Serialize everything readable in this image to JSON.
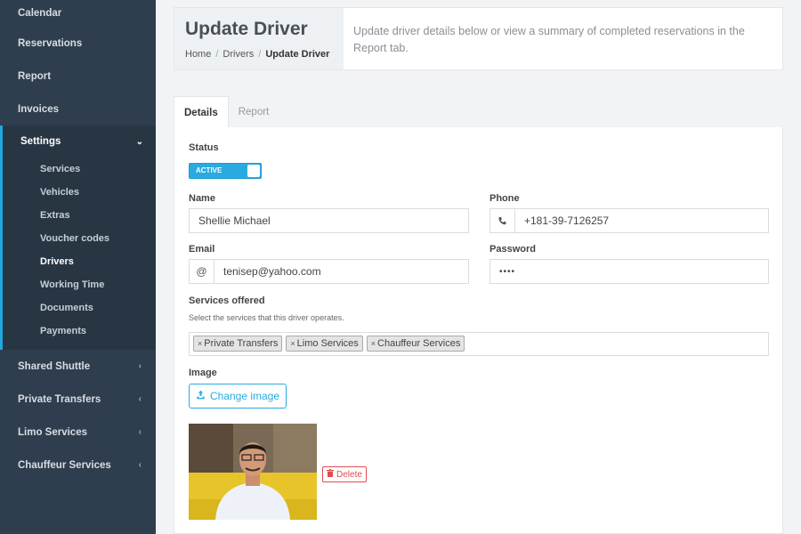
{
  "sidebar": {
    "top_items": [
      "Calendar",
      "Reservations",
      "Report",
      "Invoices"
    ],
    "settings": {
      "label": "Settings",
      "items": [
        "Services",
        "Vehicles",
        "Extras",
        "Voucher codes",
        "Drivers",
        "Working Time",
        "Documents",
        "Payments"
      ]
    },
    "bottom_items": [
      "Shared Shuttle",
      "Private Transfers",
      "Limo Services",
      "Chauffeur Services"
    ]
  },
  "header": {
    "title": "Update Driver",
    "breadcrumb": [
      "Home",
      "Drivers",
      "Update Driver"
    ],
    "description": "Update driver details below or view a summary of completed reservations in the Report tab."
  },
  "tabs": [
    "Details",
    "Report"
  ],
  "form": {
    "status_label": "Status",
    "status_value": "ACTIVE",
    "name_label": "Name",
    "name_value": "Shellie Michael",
    "phone_label": "Phone",
    "phone_value": "+181-39-7126257",
    "email_label": "Email",
    "email_value": "tenisep@yahoo.com",
    "email_addon": "@",
    "password_label": "Password",
    "password_value": "••••",
    "services_label": "Services offered",
    "services_hint": "Select the services that this driver operates.",
    "services": [
      "Private Transfers",
      "Limo Services",
      "Chauffeur Services"
    ],
    "image_label": "Image",
    "change_image": "Change image",
    "delete": "Delete"
  },
  "colors": {
    "accent": "#29abe2",
    "sidebar": "#2f3e4e",
    "danger": "#e24b4b"
  },
  "icons": [
    "chevron-down-icon",
    "chevron-left-icon",
    "phone-icon",
    "upload-icon",
    "trash-icon",
    "remove-tag-icon"
  ]
}
